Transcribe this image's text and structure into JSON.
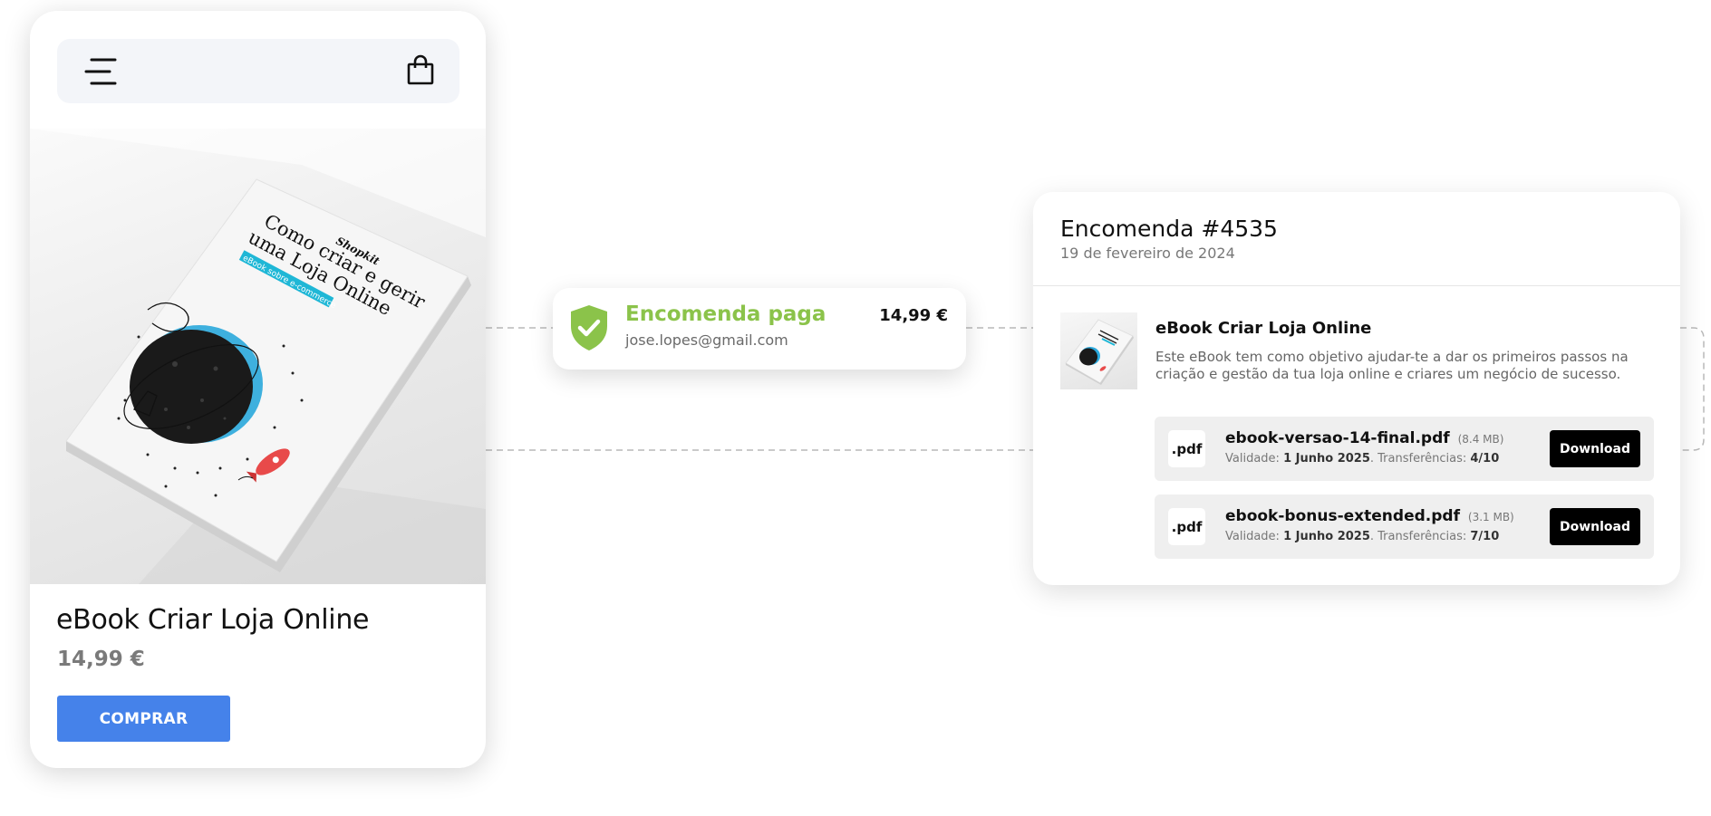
{
  "colors": {
    "accent_blue": "#4582ea",
    "success_green": "#8bc34a",
    "download_black": "#000000",
    "price_gray": "#7a7a7a"
  },
  "phone": {
    "menu_icon": "menu-icon",
    "cart_icon": "shopping-bag-icon",
    "cover": {
      "brand": "Shopkit",
      "title_line1": "Como criar e gerir",
      "title_line2": "uma Loja Online",
      "tag": "eBook sobre e-commerce"
    },
    "product_title": "eBook Criar Loja Online",
    "product_price": "14,99 €",
    "buy_label": "COMPRAR"
  },
  "notification": {
    "icon": "shield-check-icon",
    "title": "Encomenda paga",
    "email": "jose.lopes@gmail.com",
    "amount": "14,99 €"
  },
  "order": {
    "title": "Encomenda #4535",
    "date": "19 de fevereiro de 2024",
    "product_title": "eBook Criar Loja Online",
    "product_description": "Este eBook tem como objetivo ajudar-te a dar os primeiros passos na criação e gestão da tua loja online e criares um negócio de sucesso.",
    "files": [
      {
        "type": ".pdf",
        "name": "ebook-versao-14-final.pdf",
        "size": "(8.4 MB)",
        "validity_label": "Validade:",
        "validity_value": "1 Junho 2025",
        "transfers_label": "Transferências:",
        "transfers_value": "4/10",
        "download_label": "Download"
      },
      {
        "type": ".pdf",
        "name": "ebook-bonus-extended.pdf",
        "size": "(3.1 MB)",
        "validity_label": "Validade:",
        "validity_value": "1 Junho 2025",
        "transfers_label": "Transferências:",
        "transfers_value": "7/10",
        "download_label": "Download"
      }
    ]
  }
}
